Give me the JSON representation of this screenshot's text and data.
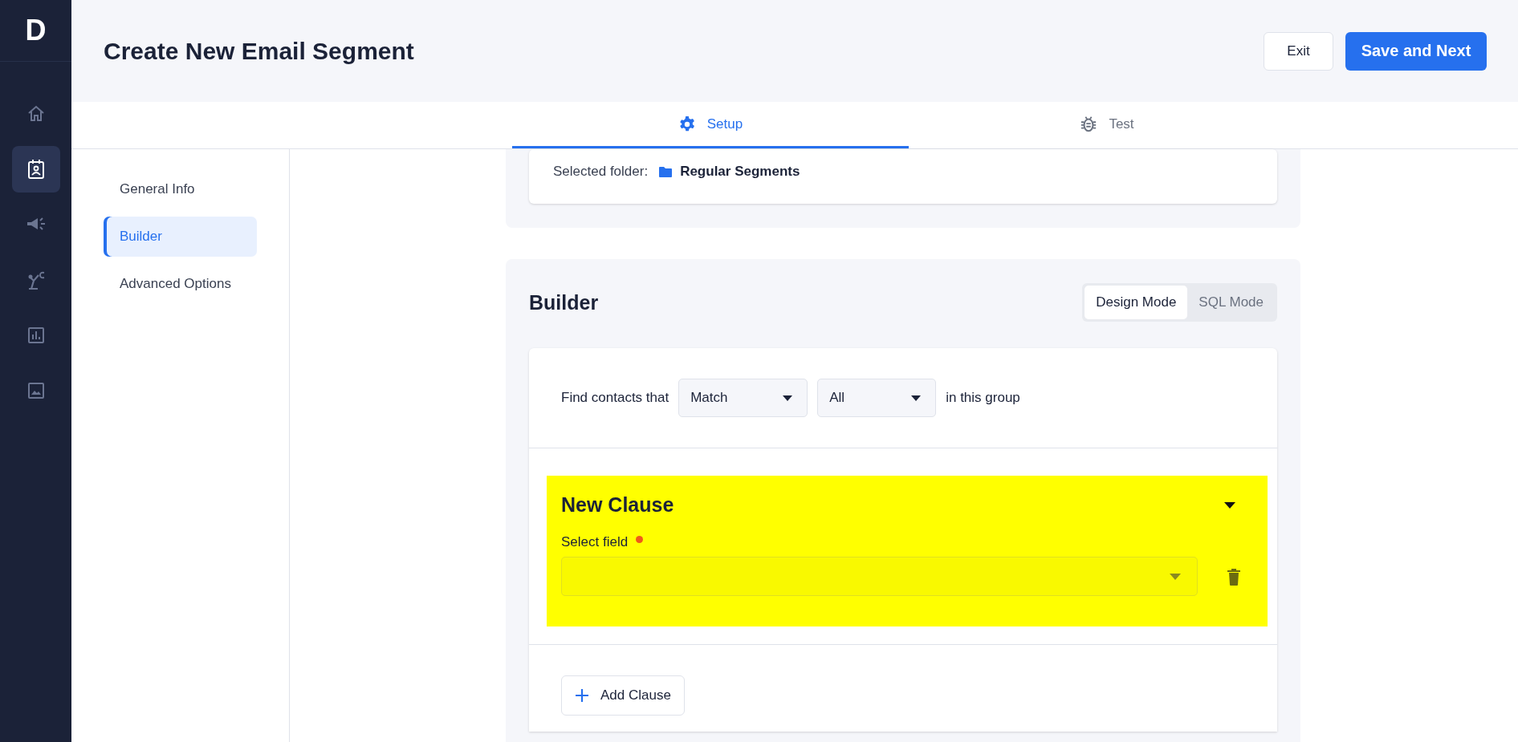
{
  "app": {
    "logo": "D"
  },
  "sidebar": {
    "items": [
      {
        "kind": "home",
        "selected": false
      },
      {
        "kind": "contact",
        "selected": true
      },
      {
        "kind": "megaphone",
        "selected": false
      },
      {
        "kind": "robot",
        "selected": false
      },
      {
        "kind": "chart",
        "selected": false
      },
      {
        "kind": "image",
        "selected": false
      }
    ]
  },
  "header": {
    "title": "Create New Email Segment",
    "buttons": [
      {
        "label": "Exit",
        "kind": "secondary"
      },
      {
        "label": "Save and Next",
        "kind": "primary"
      }
    ]
  },
  "tabs": [
    {
      "label": "Setup",
      "kind": "gear",
      "selected": true
    },
    {
      "label": "Test",
      "kind": "bug",
      "selected": false
    }
  ],
  "steps": [
    {
      "label": "General Info",
      "selected": false
    },
    {
      "label": "Builder",
      "selected": true
    },
    {
      "label": "Advanced Options",
      "selected": false
    }
  ],
  "folder": {
    "label": "Selected folder:",
    "value": "Regular Segments"
  },
  "builder": {
    "title": "Builder",
    "modes": [
      {
        "label": "Design Mode",
        "selected": true
      },
      {
        "label": "SQL Mode",
        "selected": false
      }
    ],
    "match": {
      "prefix": "Find contacts that",
      "selects": [
        "Match",
        "All"
      ],
      "suffix": "in this group"
    },
    "clause": {
      "title": "New Clause",
      "highlighted": true,
      "field_label": "Select field",
      "required": true
    },
    "add_button": "Add Clause"
  }
}
